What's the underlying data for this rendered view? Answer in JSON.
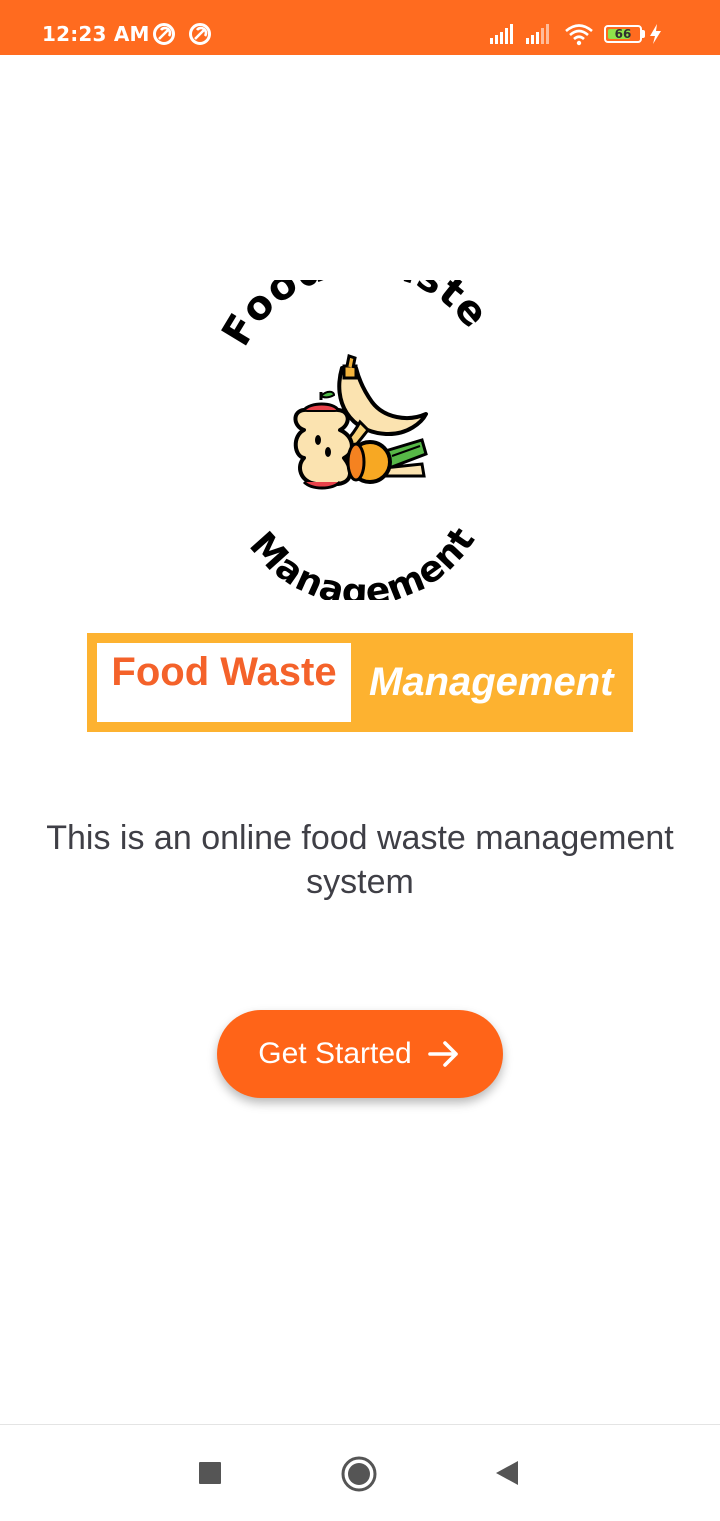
{
  "status_bar": {
    "time": "12:23 AM",
    "battery_level": "66",
    "background": "#FF6B1F",
    "icons": [
      "app-notification-icon",
      "app-notification-icon",
      "signal-icon",
      "signal-icon",
      "wifi-icon",
      "battery-icon",
      "charging-icon"
    ]
  },
  "logo": {
    "arc_top": "Food Waste",
    "arc_bottom": "Management"
  },
  "title": {
    "part1": "Food Waste",
    "part2": "Management",
    "accent": "#F4622A",
    "banner_color": "#FDB230"
  },
  "description": "This is an online food waste management system",
  "button": {
    "label": "Get Started",
    "icon": "arrow-right-icon",
    "color": "#FF6418"
  },
  "nav": {
    "items": [
      "recents-button",
      "home-button",
      "back-button"
    ]
  }
}
